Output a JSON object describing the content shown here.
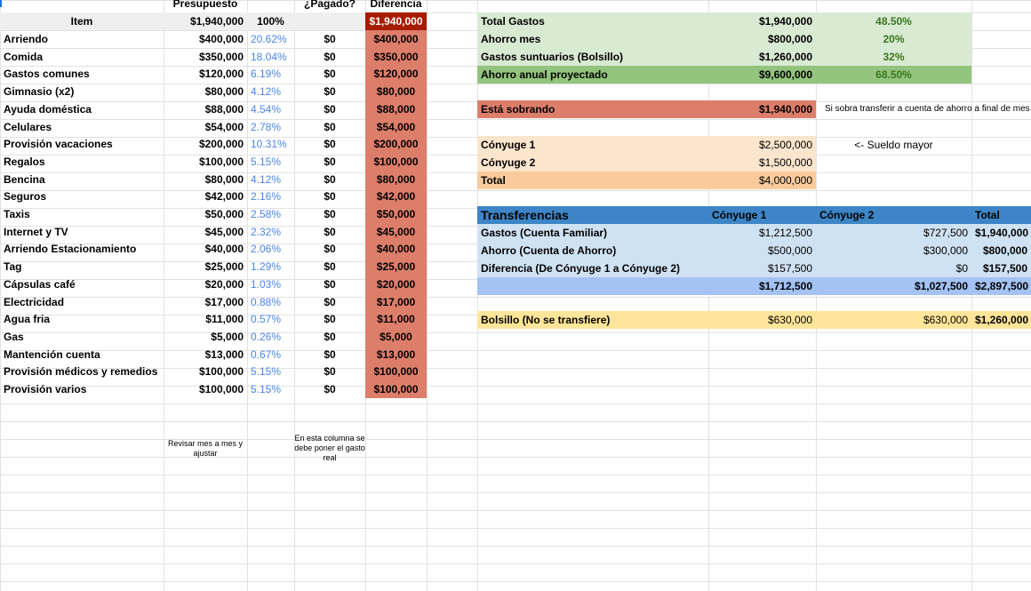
{
  "colors": {
    "grid": "#e2e2e2",
    "header_gray": "#efefef",
    "diff_red": "#dd7e6b",
    "diff_dark": "#a61c00",
    "green_light": "#d9ead3",
    "green_mid": "#93c47d",
    "peach_light": "#fce5cd",
    "peach_mid": "#f9cb9c",
    "blue_dark": "#3d85c6",
    "blue_light": "#cfe2f3",
    "blue_mid": "#a4c2f4",
    "yellow": "#ffe599",
    "pct_blue": "#4a86e8",
    "pct_green": "#38761d"
  },
  "budget": {
    "col_headers": {
      "presupuesto": "Presupuesto",
      "pagado": "¿Pagado?",
      "diferencia": "Diferencia"
    },
    "header_row": {
      "item": "Item",
      "presupuesto": "$1,940,000",
      "pct": "100%",
      "pagado": "",
      "diferencia": "$1,940,000"
    },
    "items": [
      {
        "item": "Arriendo",
        "presupuesto": "$400,000",
        "pct": "20.62%",
        "pagado": "$0",
        "diferencia": "$400,000"
      },
      {
        "item": "Comida",
        "presupuesto": "$350,000",
        "pct": "18.04%",
        "pagado": "$0",
        "diferencia": "$350,000"
      },
      {
        "item": "Gastos comunes",
        "presupuesto": "$120,000",
        "pct": "6.19%",
        "pagado": "$0",
        "diferencia": "$120,000"
      },
      {
        "item": "Gimnasio (x2)",
        "presupuesto": "$80,000",
        "pct": "4.12%",
        "pagado": "$0",
        "diferencia": "$80,000"
      },
      {
        "item": "Ayuda doméstica",
        "presupuesto": "$88,000",
        "pct": "4.54%",
        "pagado": "$0",
        "diferencia": "$88,000"
      },
      {
        "item": "Celulares",
        "presupuesto": "$54,000",
        "pct": "2.78%",
        "pagado": "$0",
        "diferencia": "$54,000"
      },
      {
        "item": "Provisión vacaciones",
        "presupuesto": "$200,000",
        "pct": "10.31%",
        "pagado": "$0",
        "diferencia": "$200,000"
      },
      {
        "item": "Regalos",
        "presupuesto": "$100,000",
        "pct": "5.15%",
        "pagado": "$0",
        "diferencia": "$100,000"
      },
      {
        "item": "Bencina",
        "presupuesto": "$80,000",
        "pct": "4.12%",
        "pagado": "$0",
        "diferencia": "$80,000"
      },
      {
        "item": "Seguros",
        "presupuesto": "$42,000",
        "pct": "2.16%",
        "pagado": "$0",
        "diferencia": "$42,000"
      },
      {
        "item": "Taxis",
        "presupuesto": "$50,000",
        "pct": "2.58%",
        "pagado": "$0",
        "diferencia": "$50,000"
      },
      {
        "item": "Internet y TV",
        "presupuesto": "$45,000",
        "pct": "2.32%",
        "pagado": "$0",
        "diferencia": "$45,000"
      },
      {
        "item": "Arriendo Estacionamiento",
        "presupuesto": "$40,000",
        "pct": "2.06%",
        "pagado": "$0",
        "diferencia": "$40,000"
      },
      {
        "item": "Tag",
        "presupuesto": "$25,000",
        "pct": "1.29%",
        "pagado": "$0",
        "diferencia": "$25,000"
      },
      {
        "item": "Cápsulas café",
        "presupuesto": "$20,000",
        "pct": "1.03%",
        "pagado": "$0",
        "diferencia": "$20,000"
      },
      {
        "item": "Electricidad",
        "presupuesto": "$17,000",
        "pct": "0.88%",
        "pagado": "$0",
        "diferencia": "$17,000"
      },
      {
        "item": "Agua fria",
        "presupuesto": "$11,000",
        "pct": "0.57%",
        "pagado": "$0",
        "diferencia": "$11,000"
      },
      {
        "item": "Gas",
        "presupuesto": "$5,000",
        "pct": "0.26%",
        "pagado": "$0",
        "diferencia": "$5,000"
      },
      {
        "item": "Mantención cuenta",
        "presupuesto": "$13,000",
        "pct": "0.67%",
        "pagado": "$0",
        "diferencia": "$13,000"
      },
      {
        "item": "Provisión médicos y remedios",
        "presupuesto": "$100,000",
        "pct": "5.15%",
        "pagado": "$0",
        "diferencia": "$100,000"
      },
      {
        "item": "Provisión varios",
        "presupuesto": "$100,000",
        "pct": "5.15%",
        "pagado": "$0",
        "diferencia": "$100,000"
      }
    ],
    "note_presupuesto": "Revisar mes a mes y ajustar",
    "note_pagado": "En esta columna se debe poner el gasto real"
  },
  "summary": {
    "rows": [
      {
        "label": "Total Gastos",
        "value": "$1,940,000",
        "pct": "48.50%"
      },
      {
        "label": "Ahorro mes",
        "value": "$800,000",
        "pct": "20%"
      },
      {
        "label": "Gastos suntuarios (Bolsillo)",
        "value": "$1,260,000",
        "pct": "32%"
      },
      {
        "label": "Ahorro anual proyectado",
        "value": "$9,600,000",
        "pct": "68.50%"
      }
    ]
  },
  "sobrando": {
    "label": "Está sobrando",
    "value": "$1,940,000",
    "note": "Si sobra transferir a cuenta de ahorro a final de mes"
  },
  "income": {
    "rows": [
      {
        "label": "Cónyuge 1",
        "value": "$2,500,000"
      },
      {
        "label": "Cónyuge 2",
        "value": "$1,500,000"
      },
      {
        "label": "Total",
        "value": "$4,000,000"
      }
    ],
    "note": "<- Sueldo mayor"
  },
  "transfers": {
    "header": {
      "label": "Transferencias",
      "c1": "Cónyuge 1",
      "c2": "Cónyuge 2",
      "total": "Total"
    },
    "rows": [
      {
        "label": "Gastos (Cuenta Familiar)",
        "c1": "$1,212,500",
        "c2": "$727,500",
        "total": "$1,940,000"
      },
      {
        "label": "Ahorro (Cuenta de Ahorro)",
        "c1": "$500,000",
        "c2": "$300,000",
        "total": "$800,000"
      },
      {
        "label": "Diferencia (De Cónyuge 1 a Cónyuge 2)",
        "c1": "$157,500",
        "c2": "$0",
        "total": "$157,500"
      }
    ],
    "totals": {
      "label": "",
      "c1": "$1,712,500",
      "c2": "$1,027,500",
      "total": "$2,897,500"
    },
    "bolsillo": {
      "label": "Bolsillo (No se transfiere)",
      "c1": "$630,000",
      "c2": "$630,000",
      "total": "$1,260,000"
    }
  }
}
